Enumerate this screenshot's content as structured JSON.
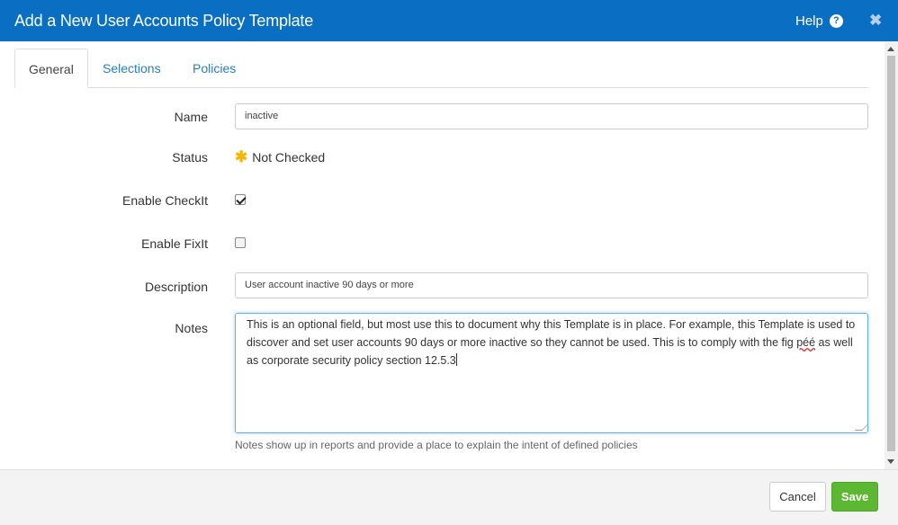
{
  "dialog": {
    "title": "Add a New User Accounts Policy Template",
    "help_label": "Help",
    "help_icon": "?",
    "close_icon": "✖"
  },
  "tabs": [
    {
      "label": "General",
      "active": true
    },
    {
      "label": "Selections",
      "active": false
    },
    {
      "label": "Policies",
      "active": false
    }
  ],
  "form": {
    "name_label": "Name",
    "name_value": "inactive",
    "status_label": "Status",
    "status_value": "Not Checked",
    "status_icon": "✱",
    "enable_checkit_label": "Enable CheckIt",
    "enable_checkit_checked": true,
    "enable_fixit_label": "Enable FixIt",
    "enable_fixit_checked": false,
    "description_label": "Description",
    "description_value": "User account inactive 90 days or more",
    "notes_label": "Notes",
    "notes_text_before": "This is an optional field, but most use this to document why this Template is in place. For example, this Template is used to discover and set user accounts 90 days or more inactive so they cannot be used. This is to comply with the fig ",
    "notes_misspelled": "péé",
    "notes_text_after": " as well as corporate security policy section 12.5.3",
    "notes_hint": "Notes show up in reports and provide a place to explain the intent of defined policies"
  },
  "footer": {
    "cancel_label": "Cancel",
    "save_label": "Save"
  },
  "colors": {
    "header": "#0a6fc2",
    "save": "#5cb832",
    "status_icon": "#f5b800",
    "tab_link": "#2a7cc1"
  }
}
